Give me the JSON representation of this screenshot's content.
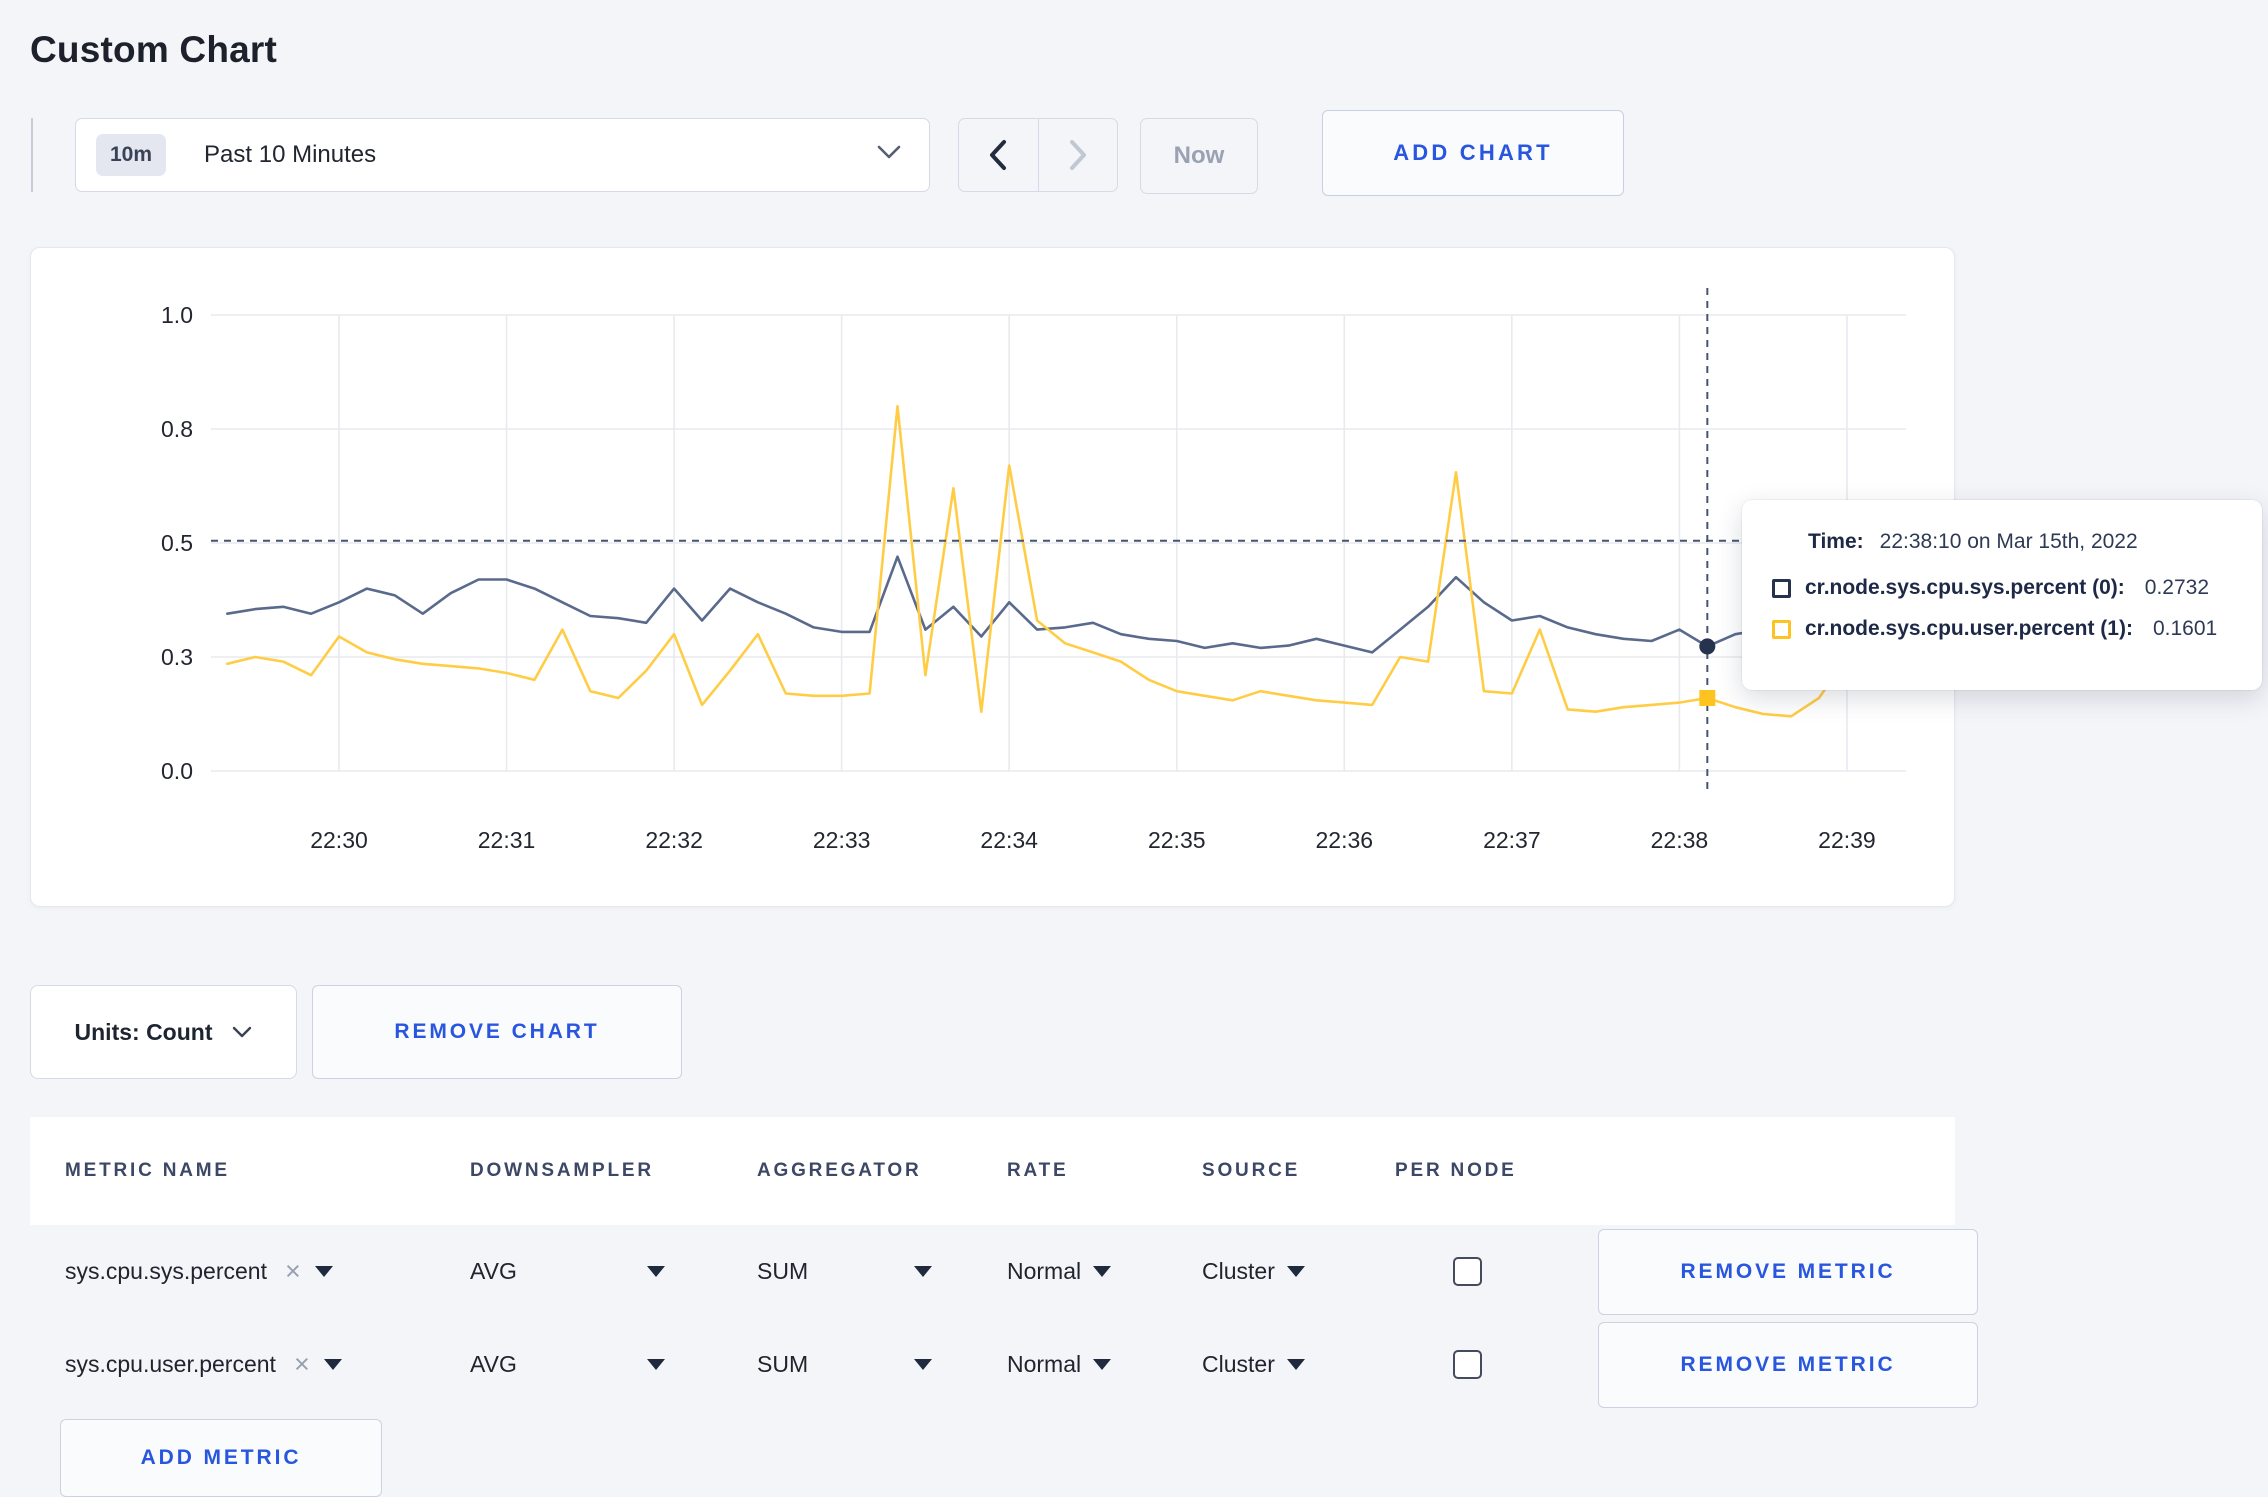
{
  "title": "Custom Chart",
  "controls": {
    "time_range": {
      "badge": "10m",
      "label": "Past 10 Minutes"
    },
    "now_label": "Now",
    "add_chart_label": "ADD CHART"
  },
  "chart_data": {
    "type": "line",
    "title": "",
    "xlabel": "",
    "ylabel": "",
    "ylim": [
      0,
      1
    ],
    "grid": true,
    "x_ticks": [
      "22:30",
      "22:31",
      "22:32",
      "22:33",
      "22:34",
      "22:35",
      "22:36",
      "22:37",
      "22:38",
      "22:39"
    ],
    "y_ticks": [
      {
        "label": "0.0",
        "value": 0
      },
      {
        "label": "0.3",
        "value": 0.25
      },
      {
        "label": "0.5",
        "value": 0.5
      },
      {
        "label": "0.8",
        "value": 0.75
      },
      {
        "label": "1.0",
        "value": 1.0
      }
    ],
    "x_start": "22:29:20",
    "x_step_seconds": 10,
    "series": [
      {
        "name": "cr.node.sys.cpu.sys.percent (0)",
        "color": "#5A6A8C",
        "marker_color": "#26334E",
        "marker": "circle",
        "values": [
          0.345,
          0.355,
          0.36,
          0.345,
          0.37,
          0.4,
          0.385,
          0.345,
          0.39,
          0.42,
          0.42,
          0.4,
          0.37,
          0.34,
          0.335,
          0.325,
          0.4,
          0.33,
          0.4,
          0.37,
          0.345,
          0.315,
          0.305,
          0.305,
          0.47,
          0.31,
          0.36,
          0.295,
          0.37,
          0.31,
          0.315,
          0.325,
          0.3,
          0.29,
          0.285,
          0.27,
          0.28,
          0.27,
          0.275,
          0.29,
          0.275,
          0.26,
          0.31,
          0.36,
          0.425,
          0.37,
          0.33,
          0.34,
          0.315,
          0.3,
          0.29,
          0.285,
          0.31,
          0.2732,
          0.3,
          0.31,
          0.3,
          0.305,
          0.31,
          0.315,
          0.32
        ]
      },
      {
        "name": "cr.node.sys.cpu.user.percent (1)",
        "color": "#FFCD45",
        "marker_color": "#FFC321",
        "marker": "square",
        "values": [
          0.235,
          0.25,
          0.24,
          0.21,
          0.295,
          0.26,
          0.245,
          0.235,
          0.23,
          0.225,
          0.215,
          0.2,
          0.31,
          0.175,
          0.16,
          0.22,
          0.3,
          0.145,
          0.22,
          0.3,
          0.17,
          0.165,
          0.165,
          0.17,
          0.8,
          0.21,
          0.62,
          0.13,
          0.67,
          0.33,
          0.28,
          0.26,
          0.24,
          0.2,
          0.175,
          0.165,
          0.155,
          0.175,
          0.165,
          0.155,
          0.15,
          0.145,
          0.25,
          0.24,
          0.655,
          0.175,
          0.17,
          0.31,
          0.135,
          0.13,
          0.14,
          0.145,
          0.15,
          0.1601,
          0.14,
          0.125,
          0.12,
          0.16,
          0.25,
          0.28,
          0.22
        ]
      }
    ],
    "crosshair": {
      "time": "22:38:10",
      "hover_value": 0.505,
      "series_values": [
        0.2732,
        0.1601
      ]
    },
    "legend_position": "tooltip"
  },
  "tooltip": {
    "time_label": "Time:",
    "time_value": "22:38:10 on Mar 15th, 2022",
    "rows": [
      {
        "label": "cr.node.sys.cpu.sys.percent (0):",
        "value": "0.2732",
        "color": "#26334E"
      },
      {
        "label": "cr.node.sys.cpu.user.percent (1):",
        "value": "0.1601",
        "color": "#FFC321"
      }
    ]
  },
  "units_row": {
    "units_label": "Units: Count",
    "remove_chart_label": "REMOVE CHART"
  },
  "table": {
    "headers": [
      "METRIC NAME",
      "DOWNSAMPLER",
      "AGGREGATOR",
      "RATE",
      "SOURCE",
      "PER NODE"
    ],
    "clear_symbol": "×",
    "rows": [
      {
        "metric": "sys.cpu.sys.percent",
        "downsampler": "AVG",
        "aggregator": "SUM",
        "rate": "Normal",
        "source": "Cluster",
        "per_node_checked": false,
        "remove_label": "REMOVE METRIC"
      },
      {
        "metric": "sys.cpu.user.percent",
        "downsampler": "AVG",
        "aggregator": "SUM",
        "rate": "Normal",
        "source": "Cluster",
        "per_node_checked": false,
        "remove_label": "REMOVE METRIC"
      }
    ],
    "add_metric_label": "ADD METRIC"
  }
}
